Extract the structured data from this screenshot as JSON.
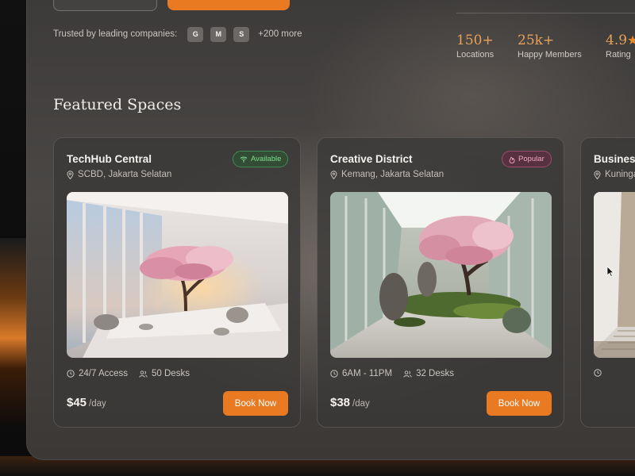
{
  "trusted": {
    "label": "Trusted by leading companies:",
    "logos": [
      "G",
      "M",
      "S"
    ],
    "more": "+200 more"
  },
  "stats": [
    {
      "value": "150+",
      "caption": "Locations"
    },
    {
      "value": "25k+",
      "caption": "Happy Members"
    },
    {
      "value": "4.9",
      "caption": "Rating"
    }
  ],
  "section_title": "Featured Spaces",
  "cards": [
    {
      "title": "TechHub Central",
      "location": "SCBD, Jakarta Selatan",
      "badge": "Available",
      "hours": "24/7 Access",
      "desks": "50 Desks",
      "price": "$45",
      "unit": "/day",
      "cta": "Book Now"
    },
    {
      "title": "Creative District",
      "location": "Kemang, Jakarta Selatan",
      "badge": "Popular",
      "hours": "6AM - 11PM",
      "desks": "32 Desks",
      "price": "$38",
      "unit": "/day",
      "cta": "Book Now"
    },
    {
      "title": "Business",
      "location": "Kuninga"
    }
  ],
  "colors": {
    "accent": "#ea7a22",
    "stat": "#e8a15a",
    "available": "#7fdc91",
    "popular": "#f0a6c4"
  },
  "icons": [
    "location-pin-icon",
    "wifi-icon",
    "flame-icon",
    "clock-icon",
    "users-icon",
    "star-icon",
    "cursor-icon"
  ]
}
